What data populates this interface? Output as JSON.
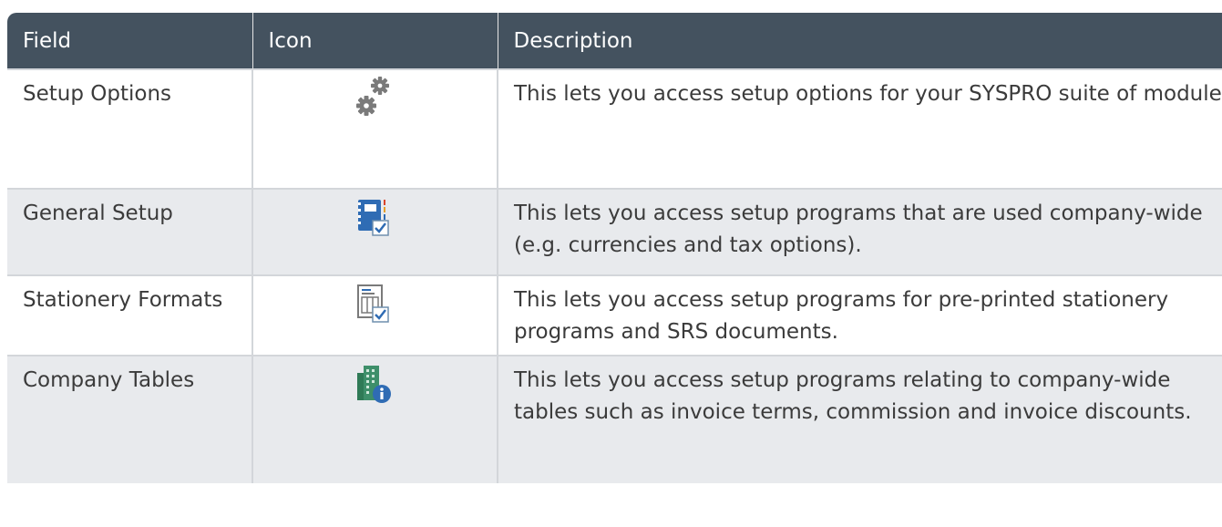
{
  "table": {
    "headers": {
      "field": "Field",
      "icon": "Icon",
      "description": "Description"
    },
    "rows": [
      {
        "field": "Setup Options",
        "icon": "gears-icon",
        "description": "This lets you access setup options for your SYSPRO suite of modules"
      },
      {
        "field": "General Setup",
        "icon": "notebook-check-icon",
        "description": "This lets you access setup programs that are used company-wide (e.g. currencies and tax options)."
      },
      {
        "field": "Stationery Formats",
        "icon": "document-layout-check-icon",
        "description": "This lets you access setup programs for pre-printed stationery programs and SRS documents."
      },
      {
        "field": "Company Tables",
        "icon": "building-info-icon",
        "description": "This lets you access setup programs relating to company-wide tables such as invoice terms, commission and invoice discounts."
      }
    ]
  },
  "colors": {
    "header_bg": "#44525f",
    "row_alt_bg": "#e8eaed",
    "border": "#d3d6da",
    "icon_blue": "#2f6cb4",
    "icon_green": "#3e8f6a",
    "icon_gray": "#7a7a7a"
  }
}
